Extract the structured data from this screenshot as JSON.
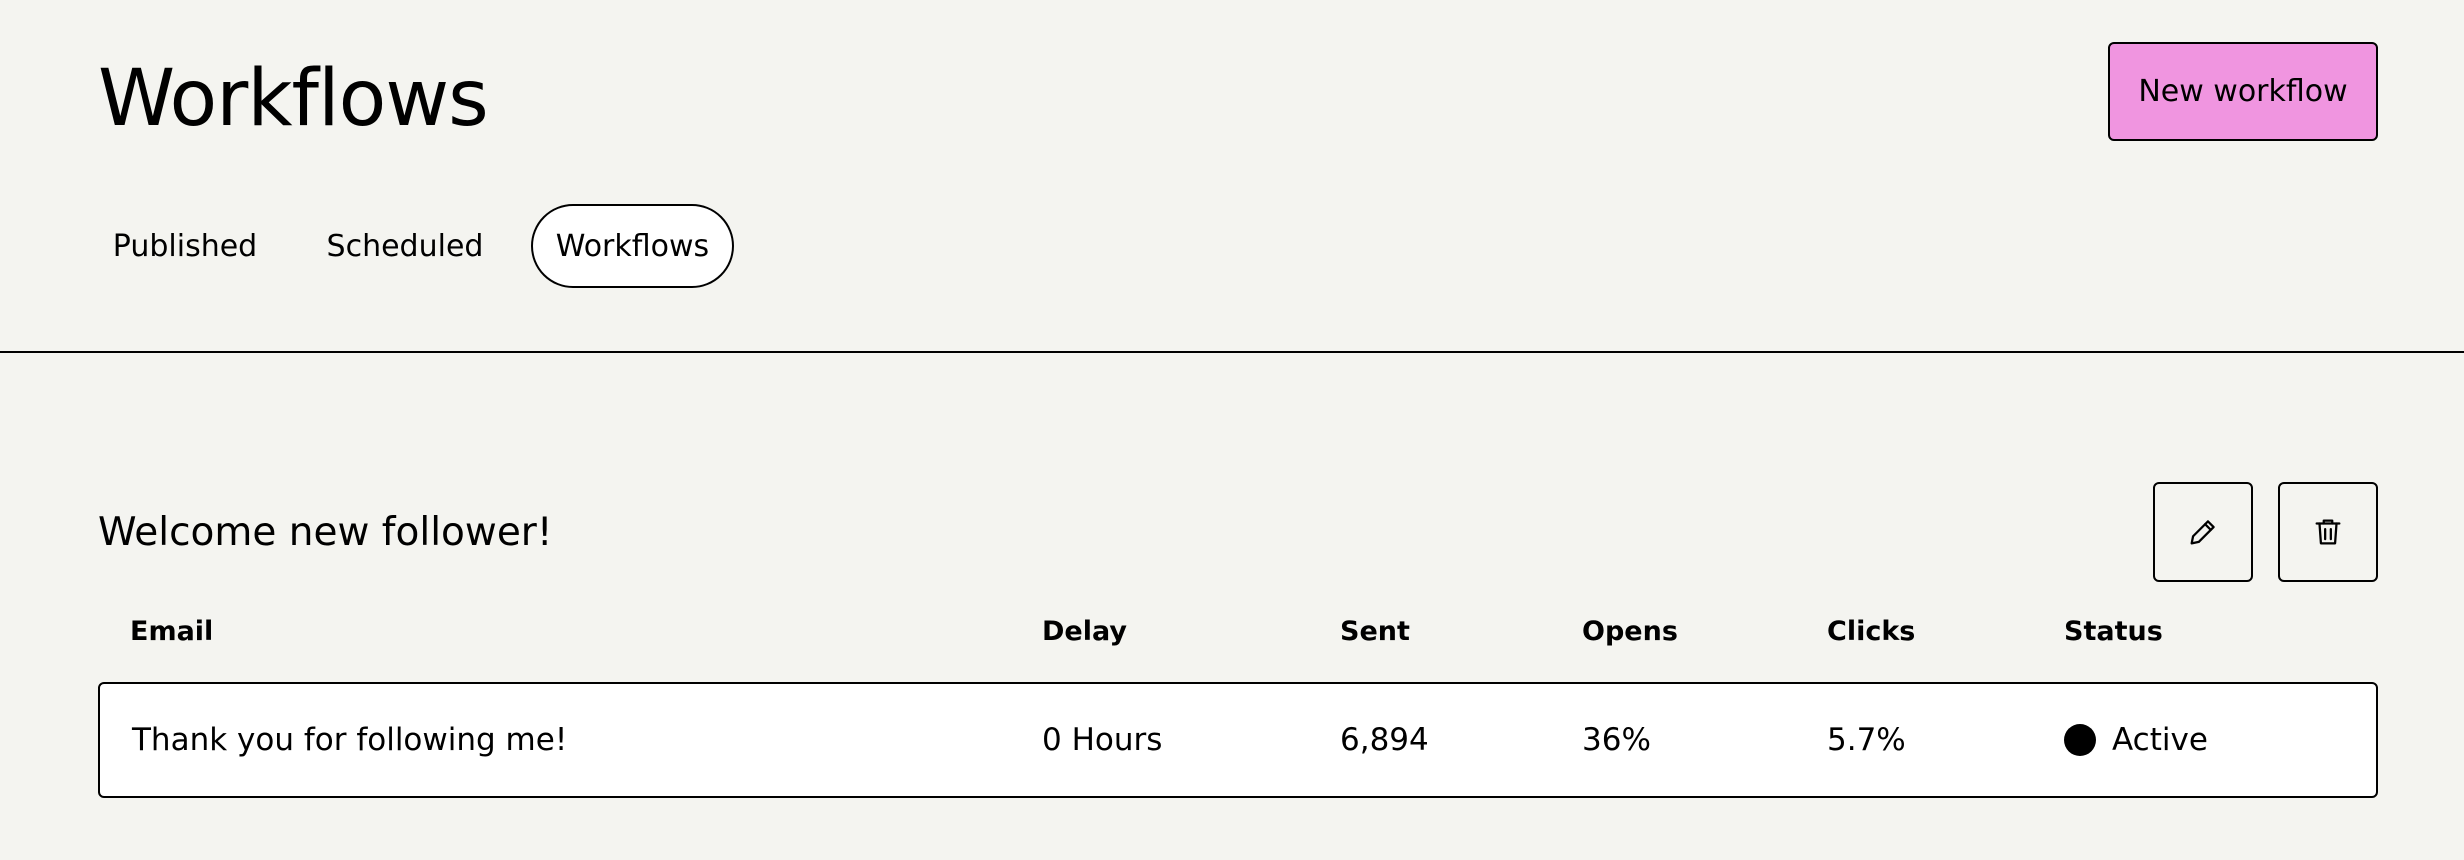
{
  "header": {
    "title": "Workflows",
    "new_button_label": "New workflow"
  },
  "tabs": [
    {
      "label": "Published",
      "active": false
    },
    {
      "label": "Scheduled",
      "active": false
    },
    {
      "label": "Workflows",
      "active": true
    }
  ],
  "workflow": {
    "title": "Welcome new follower!",
    "actions": {
      "edit_icon": "pencil-icon",
      "delete_icon": "trash-icon"
    },
    "columns": [
      "Email",
      "Delay",
      "Sent",
      "Opens",
      "Clicks",
      "Status"
    ],
    "rows": [
      {
        "email": "Thank you for following me!",
        "delay": "0 Hours",
        "sent": "6,894",
        "opens": "36%",
        "clicks": "5.7%",
        "status": "Active"
      }
    ]
  },
  "colors": {
    "background": "#f4f4f0",
    "accent": "#f095e0",
    "status_active": "#000000"
  }
}
